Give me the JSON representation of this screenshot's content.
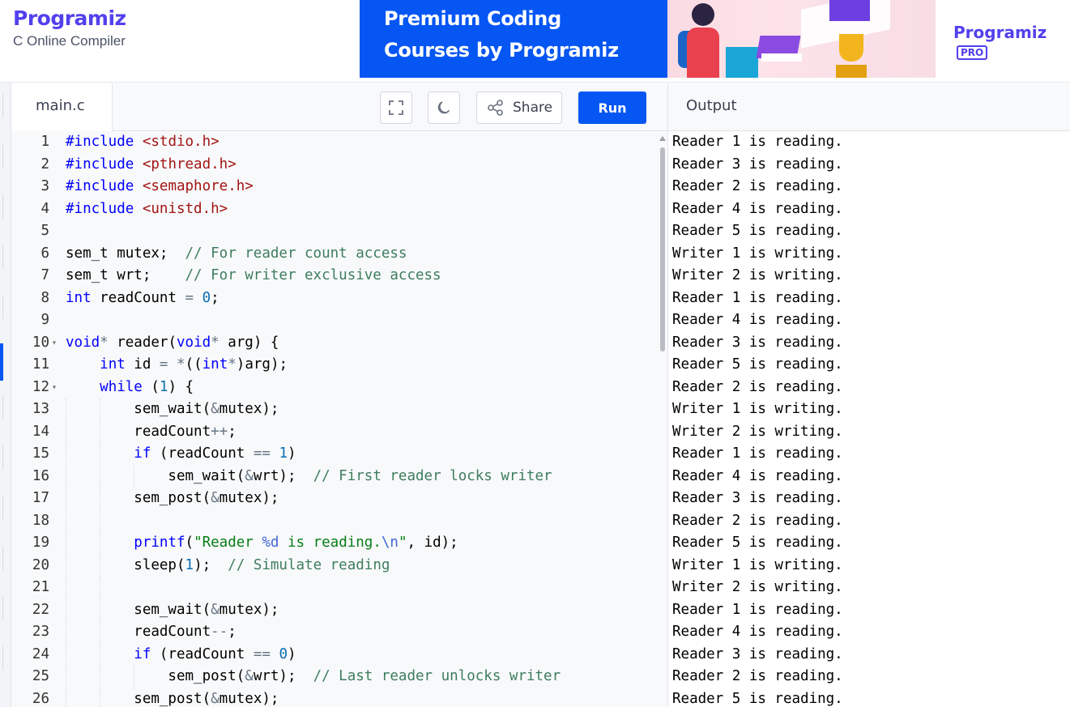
{
  "brand": {
    "logo": "Programiz",
    "subtitle": "C Online Compiler"
  },
  "banner": {
    "headline_line1": "Premium Coding",
    "headline_line2": "Courses by Programiz",
    "logo": "Programiz",
    "badge": "PRO"
  },
  "editor": {
    "file_tab": "main.c",
    "share_label": "Share",
    "run_label": "Run",
    "lines": [
      {
        "n": "1",
        "fold": "",
        "indent": 0,
        "html": "<span class='kw'>#include</span> <span class='str'>&lt;stdio.h&gt;</span>"
      },
      {
        "n": "2",
        "fold": "",
        "indent": 0,
        "html": "<span class='kw'>#include</span> <span class='str'>&lt;pthread.h&gt;</span>"
      },
      {
        "n": "3",
        "fold": "",
        "indent": 0,
        "html": "<span class='kw'>#include</span> <span class='str'>&lt;semaphore.h&gt;</span>"
      },
      {
        "n": "4",
        "fold": "",
        "indent": 0,
        "html": "<span class='kw'>#include</span> <span class='str'>&lt;unistd.h&gt;</span>"
      },
      {
        "n": "5",
        "fold": "",
        "indent": 0,
        "html": ""
      },
      {
        "n": "6",
        "fold": "",
        "indent": 0,
        "html": "sem_t mutex;  <span class='cm'>// For reader count access</span>"
      },
      {
        "n": "7",
        "fold": "",
        "indent": 0,
        "html": "sem_t wrt;    <span class='cm'>// For writer exclusive access</span>"
      },
      {
        "n": "8",
        "fold": "",
        "indent": 0,
        "html": "<span class='kw'>int</span> readCount <span class='op'>=</span> <span class='num'>0</span>;"
      },
      {
        "n": "9",
        "fold": "",
        "indent": 0,
        "html": ""
      },
      {
        "n": "10",
        "fold": "▾",
        "indent": 0,
        "html": "<span class='kw'>void</span><span class='op'>*</span> reader(<span class='kw'>void</span><span class='op'>*</span> arg) {"
      },
      {
        "n": "11",
        "fold": "",
        "indent": 1,
        "html": "    <span class='kw'>int</span> id <span class='op'>=</span> <span class='op'>*</span>((<span class='kw'>int</span><span class='op'>*</span>)arg);"
      },
      {
        "n": "12",
        "fold": "▾",
        "indent": 1,
        "html": "    <span class='kw'>while</span> (<span class='num'>1</span>) {"
      },
      {
        "n": "13",
        "fold": "",
        "indent": 2,
        "html": "        sem_wait(<span class='op'>&amp;</span>mutex);"
      },
      {
        "n": "14",
        "fold": "",
        "indent": 2,
        "html": "        readCount<span class='op'>++</span>;"
      },
      {
        "n": "15",
        "fold": "",
        "indent": 2,
        "html": "        <span class='kw'>if</span> (readCount <span class='op'>==</span> <span class='num'>1</span>)"
      },
      {
        "n": "16",
        "fold": "",
        "indent": 3,
        "html": "            sem_wait(<span class='op'>&amp;</span>wrt);  <span class='cm'>// First reader locks writer</span>"
      },
      {
        "n": "17",
        "fold": "",
        "indent": 2,
        "html": "        sem_post(<span class='op'>&amp;</span>mutex);"
      },
      {
        "n": "18",
        "fold": "",
        "indent": 2,
        "html": ""
      },
      {
        "n": "19",
        "fold": "",
        "indent": 2,
        "html": "        <span class='kw'>printf</span>(<span class='strg'>\"Reader <span class='esc'>%d</span> is reading.<span class='esc'>\\n</span>\"</span>, id);"
      },
      {
        "n": "20",
        "fold": "",
        "indent": 2,
        "html": "        sleep(<span class='num'>1</span>);  <span class='cm'>// Simulate reading</span>"
      },
      {
        "n": "21",
        "fold": "",
        "indent": 2,
        "html": ""
      },
      {
        "n": "22",
        "fold": "",
        "indent": 2,
        "html": "        sem_wait(<span class='op'>&amp;</span>mutex);"
      },
      {
        "n": "23",
        "fold": "",
        "indent": 2,
        "html": "        readCount<span class='op'>--</span>;"
      },
      {
        "n": "24",
        "fold": "",
        "indent": 2,
        "html": "        <span class='kw'>if</span> (readCount <span class='op'>==</span> <span class='num'>0</span>)"
      },
      {
        "n": "25",
        "fold": "",
        "indent": 3,
        "html": "            sem_post(<span class='op'>&amp;</span>wrt);  <span class='cm'>// Last reader unlocks writer</span>"
      },
      {
        "n": "26",
        "fold": "",
        "indent": 2,
        "html": "        sem_post(<span class='op'>&amp;</span>mutex);"
      }
    ]
  },
  "output": {
    "title": "Output",
    "lines": [
      "Reader 1 is reading.",
      "Reader 3 is reading.",
      "Reader 2 is reading.",
      "Reader 4 is reading.",
      "Reader 5 is reading.",
      "Writer 1 is writing.",
      "Writer 2 is writing.",
      "Reader 1 is reading.",
      "Reader 4 is reading.",
      "Reader 3 is reading.",
      "Reader 5 is reading.",
      "Reader 2 is reading.",
      "Writer 1 is writing.",
      "Writer 2 is writing.",
      "Reader 1 is reading.",
      "Reader 4 is reading.",
      "Reader 3 is reading.",
      "Reader 2 is reading.",
      "Reader 5 is reading.",
      "Writer 1 is writing.",
      "Writer 2 is writing.",
      "Reader 1 is reading.",
      "Reader 4 is reading.",
      "Reader 3 is reading.",
      "Reader 2 is reading.",
      "Reader 5 is reading."
    ]
  },
  "icons": {
    "fullscreen": "fullscreen-icon",
    "theme": "moon-icon",
    "share": "share-icon"
  },
  "colors": {
    "brand": "#5240ed",
    "run_button": "#0556f3",
    "banner_blue": "#0556f3"
  }
}
